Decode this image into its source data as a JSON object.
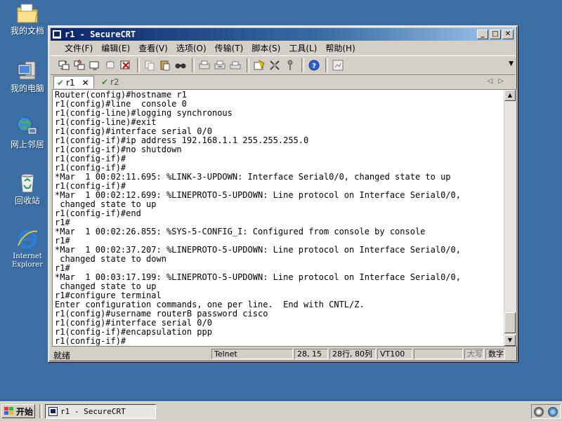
{
  "desktop": {
    "icons": [
      {
        "label": "我的文档"
      },
      {
        "label": "我的电脑"
      },
      {
        "label": "网上邻居"
      },
      {
        "label": "回收站"
      },
      {
        "label": "Internet Explorer"
      }
    ]
  },
  "window": {
    "title": "r1 - SecureCRT",
    "buttons": {
      "minimize": "_",
      "maximize": "□",
      "close": "✕"
    },
    "menu": [
      "文件(F)",
      "编辑(E)",
      "查看(V)",
      "选项(O)",
      "传输(T)",
      "脚本(S)",
      "工具(L)",
      "帮助(H)"
    ],
    "toolbar_icons": [
      "connect-icon",
      "quick-connect-icon",
      "connect-tab-icon",
      "reconnect-icon",
      "disconnect-icon",
      "copy-icon",
      "paste-icon",
      "find-icon",
      "print-setup-icon",
      "print-selection-icon",
      "print-icon",
      "session-options-icon",
      "global-options-icon",
      "keymap-icon",
      "help-icon",
      "log-icon"
    ],
    "tabs": [
      {
        "label": "r1",
        "active": true,
        "close": "✕"
      },
      {
        "label": "r2",
        "active": false
      }
    ],
    "tab_nav": {
      "prev": "◁",
      "next": "▷"
    },
    "terminal": {
      "lines": [
        "Router(config)#hostname r1",
        "r1(config)#line  console 0",
        "r1(config-line)#logging synchronous",
        "r1(config-line)#exit",
        "r1(config)#interface serial 0/0",
        "r1(config-if)#ip address 192.168.1.1 255.255.255.0",
        "r1(config-if)#no shutdown",
        "r1(config-if)#",
        "r1(config-if)#",
        "*Mar  1 00:02:11.695: %LINK-3-UPDOWN: Interface Serial0/0, changed state to up",
        "r1(config-if)#",
        "*Mar  1 00:02:12.699: %LINEPROTO-5-UPDOWN: Line protocol on Interface Serial0/0,",
        " changed state to up",
        "r1(config-if)#end",
        "r1#",
        "*Mar  1 00:02:26.855: %SYS-5-CONFIG_I: Configured from console by console",
        "r1#",
        "*Mar  1 00:02:37.207: %LINEPROTO-5-UPDOWN: Line protocol on Interface Serial0/0,",
        " changed state to down",
        "r1#",
        "*Mar  1 00:03:17.199: %LINEPROTO-5-UPDOWN: Line protocol on Interface Serial0/0,",
        " changed state to up",
        "r1#configure terminal",
        "Enter configuration commands, one per line.  End with CNTL/Z.",
        "r1(config)#username routerB password cisco",
        "r1(config)#interface serial 0/0",
        "r1(config-if)#encapsulation ppp",
        "r1(config-if)#"
      ]
    },
    "status": {
      "ready": "就绪",
      "protocol": "Telnet",
      "cursor": "28, 15",
      "size": "28行, 80列",
      "terminal_type": "VT100",
      "caps": "大写",
      "num": "数字"
    }
  },
  "taskbar": {
    "start_label": "开始",
    "task_label": "r1 - SecureCRT"
  }
}
